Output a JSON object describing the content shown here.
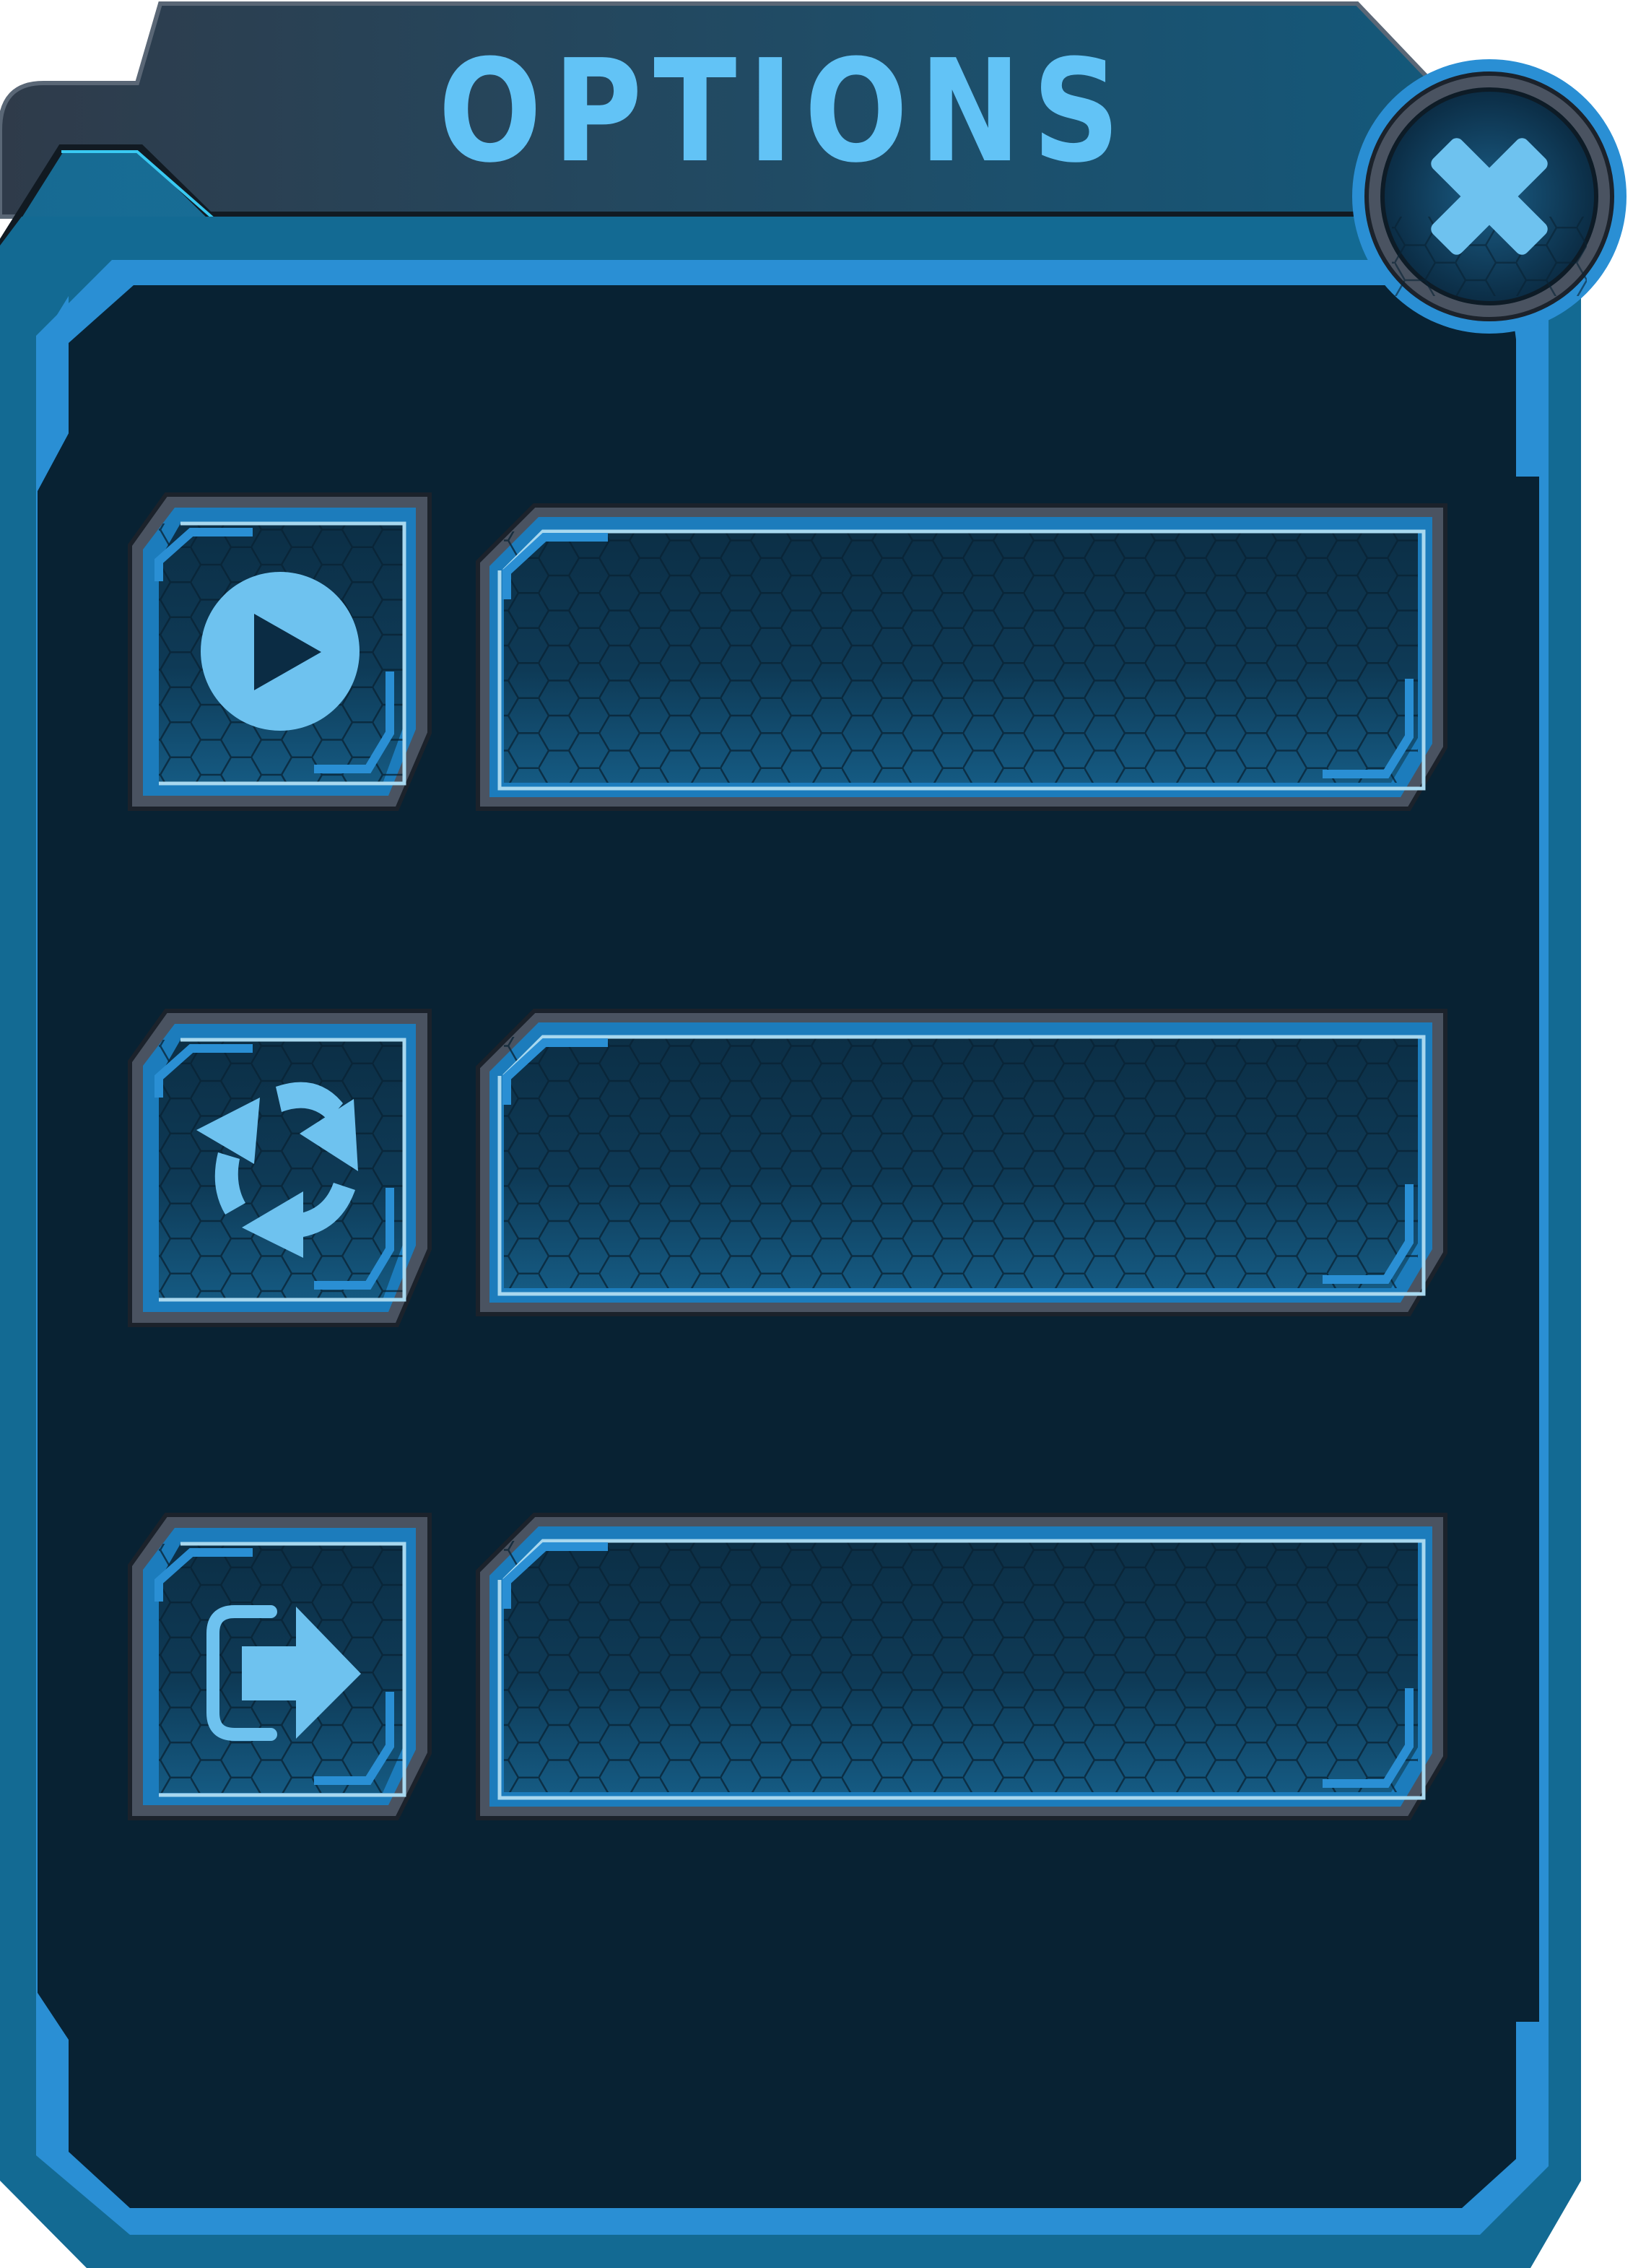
{
  "dialog": {
    "title": "OPTIONS"
  },
  "close_button": {
    "icon": "close-icon"
  },
  "options": [
    {
      "icon": "play-icon",
      "label": ""
    },
    {
      "icon": "restart-icon",
      "label": ""
    },
    {
      "icon": "exit-icon",
      "label": ""
    }
  ],
  "colors": {
    "panel_dark": "#082233",
    "frame_blue": "#2a8fd4",
    "frame_teal": "#136a93",
    "header_dark": "#2e3c4c",
    "header_teal": "#17536e",
    "icon_light": "#6ec2ef",
    "title_text": "#62c3f6",
    "slot_gray": "#3a4552"
  }
}
